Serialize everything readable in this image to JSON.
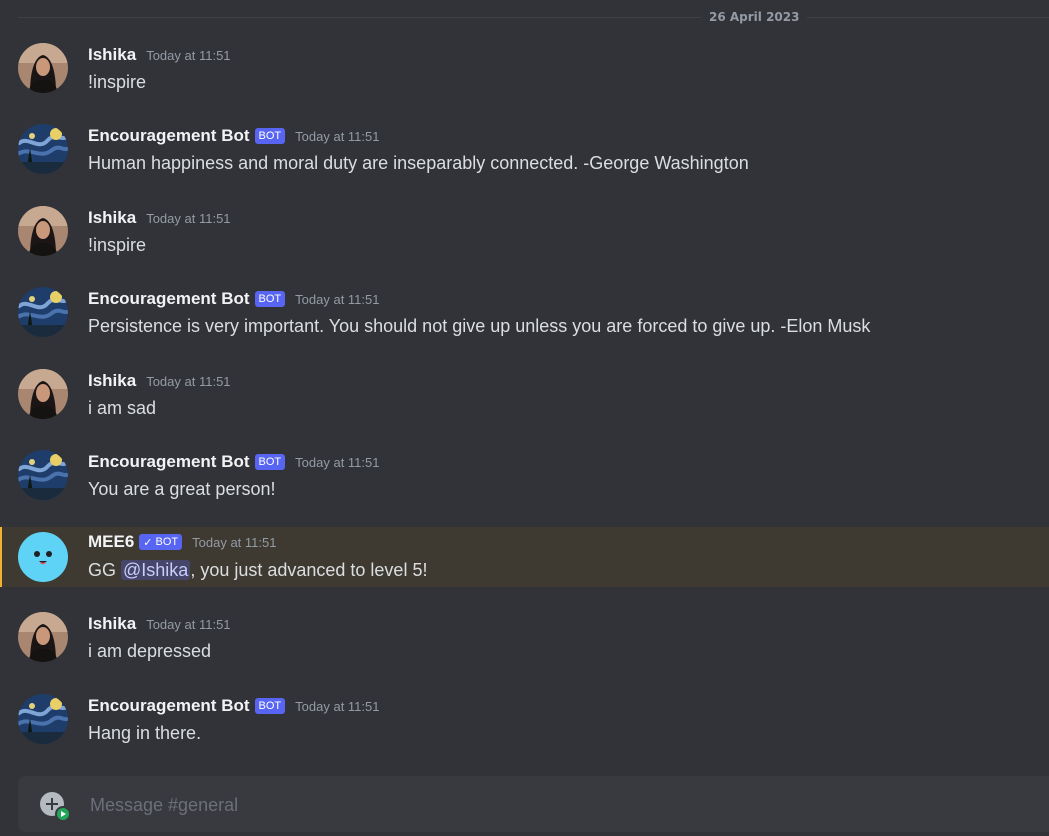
{
  "date_divider": "26 April 2023",
  "colors": {
    "background": "#313338",
    "bot_tag": "#5865f2",
    "mention_highlight": "#3e3a32",
    "mention_bar": "#f0b232"
  },
  "messages": [
    {
      "author": "Ishika",
      "timestamp": "Today at 11:51",
      "content": "!inspire",
      "avatar": "ishika-avatar"
    },
    {
      "author": "Encouragement Bot",
      "bot_tag": "BOT",
      "timestamp": "Today at 11:51",
      "content": "Human happiness and moral duty are inseparably connected.  -George Washington",
      "avatar": "starry-night-avatar"
    },
    {
      "author": "Ishika",
      "timestamp": "Today at 11:51",
      "content": "!inspire",
      "avatar": "ishika-avatar"
    },
    {
      "author": "Encouragement Bot",
      "bot_tag": "BOT",
      "timestamp": "Today at 11:51",
      "content": "Persistence is very important. You should not give up unless you are forced to give up. -Elon Musk",
      "avatar": "starry-night-avatar"
    },
    {
      "author": "Ishika",
      "timestamp": "Today at 11:51",
      "content": "i am sad",
      "avatar": "ishika-avatar"
    },
    {
      "author": "Encouragement Bot",
      "bot_tag": "BOT",
      "timestamp": "Today at 11:51",
      "content": "You are a great person!",
      "avatar": "starry-night-avatar"
    },
    {
      "author": "MEE6",
      "bot_tag": "BOT",
      "verified": true,
      "verified_icon": "check-icon",
      "timestamp": "Today at 11:51",
      "content_before": "GG ",
      "mention": "@Ishika",
      "content_after": ", you just advanced to level 5!",
      "avatar": "mee6-avatar"
    },
    {
      "author": "Ishika",
      "timestamp": "Today at 11:51",
      "content": "i am depressed",
      "avatar": "ishika-avatar"
    },
    {
      "author": "Encouragement Bot",
      "bot_tag": "BOT",
      "timestamp": "Today at 11:51",
      "content": "Hang in there.",
      "avatar": "starry-night-avatar"
    }
  ],
  "composer": {
    "placeholder": "Message #general",
    "add_icon": "add-circle-icon"
  }
}
